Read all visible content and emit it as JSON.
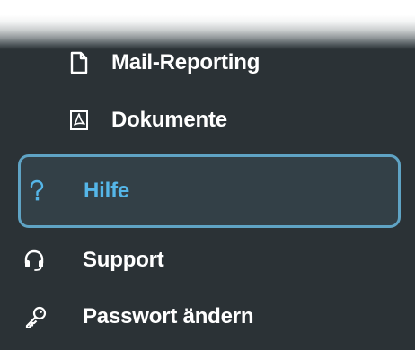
{
  "nav": {
    "items": [
      {
        "label": "Mail-Reporting",
        "icon": "document-icon"
      },
      {
        "label": "Dokumente",
        "icon": "pdf-document-icon"
      },
      {
        "label": "Hilfe",
        "icon": "help-icon",
        "active": true
      },
      {
        "label": "Support",
        "icon": "headset-icon"
      },
      {
        "label": "Passwort ändern",
        "icon": "key-icon"
      }
    ]
  },
  "colors": {
    "background": "#2b3236",
    "text": "#ffffff",
    "active_text": "#55b6e8",
    "active_border": "#5fa3c4",
    "active_background": "#334047"
  }
}
